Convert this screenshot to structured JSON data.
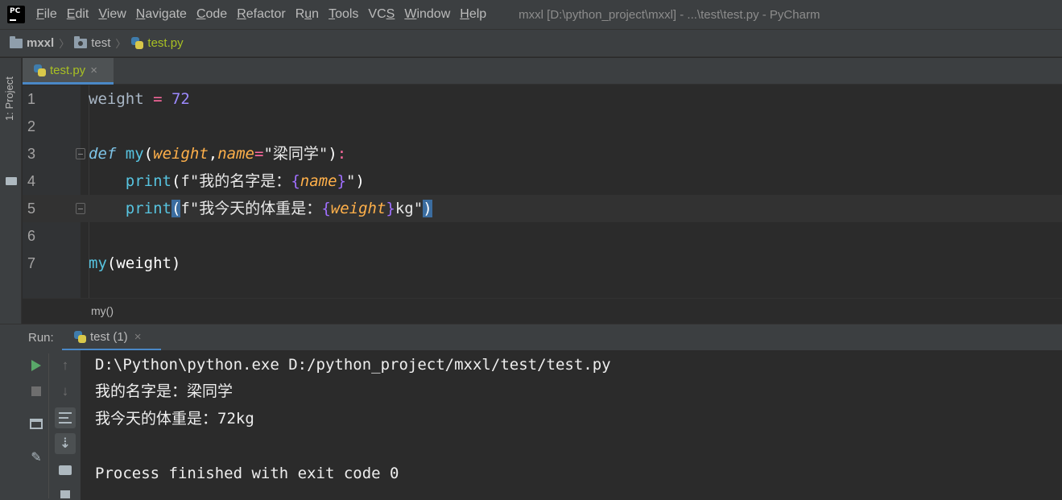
{
  "menubar": {
    "items": [
      {
        "pre": "",
        "key": "F",
        "post": "ile"
      },
      {
        "pre": "",
        "key": "E",
        "post": "dit"
      },
      {
        "pre": "",
        "key": "V",
        "post": "iew"
      },
      {
        "pre": "",
        "key": "N",
        "post": "avigate"
      },
      {
        "pre": "",
        "key": "C",
        "post": "ode"
      },
      {
        "pre": "",
        "key": "R",
        "post": "efactor"
      },
      {
        "pre": "R",
        "key": "u",
        "post": "n"
      },
      {
        "pre": "",
        "key": "T",
        "post": "ools"
      },
      {
        "pre": "VC",
        "key": "S",
        "post": ""
      },
      {
        "pre": "",
        "key": "W",
        "post": "indow"
      },
      {
        "pre": "",
        "key": "H",
        "post": "elp"
      }
    ],
    "window_title": "mxxl [D:\\python_project\\mxxl] - ...\\test\\test.py - PyCharm",
    "app_icon_text": "PC"
  },
  "breadcrumb": {
    "project": "mxxl",
    "folder": "test",
    "file": "test.py"
  },
  "left_strip": {
    "project_tab": "1: Project"
  },
  "editor": {
    "tab_label": "test.py",
    "tab_close": "×",
    "line_numbers": [
      "1",
      "2",
      "3",
      "4",
      "5",
      "6",
      "7"
    ],
    "lines": [
      {
        "t1": "weight",
        "t2": " = ",
        "t3": "72"
      },
      {},
      {
        "kw": "def",
        "fn": "my",
        "p1": "(",
        "param1": "weight",
        "comma": ",",
        "param2": "name",
        "eq": "=",
        "str": "\"梁同学\"",
        "p2": ")",
        "colon": ":"
      },
      {
        "indent": "    ",
        "bi": "print",
        "open": "(",
        "pre": "f\"我的名字是：",
        "lb": "{",
        "var": "name",
        "rb": "}",
        "post": "\"",
        "close": ")"
      },
      {
        "indent": "    ",
        "bi": "print",
        "open": "(",
        "pre": "f\"我今天的体重是：",
        "lb": "{",
        "var": "weight",
        "rb": "}",
        "post": "kg\"",
        "close": ")"
      },
      {},
      {
        "fn": "my",
        "args": "(weight)"
      }
    ],
    "context_crumb": "my()"
  },
  "run": {
    "label": "Run:",
    "tab_label": "test (1)",
    "tab_close": "×",
    "console_lines": [
      "D:\\Python\\python.exe D:/python_project/mxxl/test/test.py",
      "我的名字是：梁同学",
      "我今天的体重是：72kg",
      "",
      "Process finished with exit code 0"
    ]
  },
  "colors": {
    "accent": "#4a88c7",
    "file_green": "#a8c023",
    "run_green": "#59a869"
  }
}
